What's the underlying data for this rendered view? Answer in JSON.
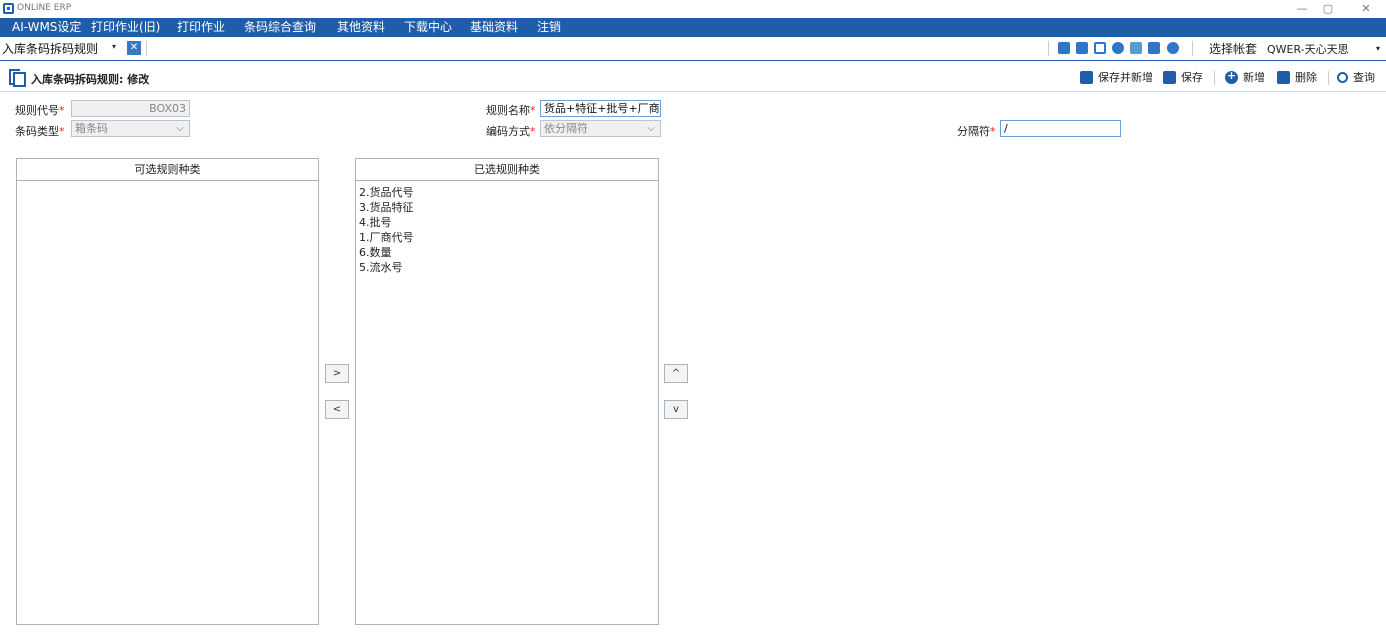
{
  "window": {
    "app_title": "ONLINE ERP",
    "minimize_glyph": "—",
    "maximize_glyph": "▢",
    "close_glyph": "✕"
  },
  "menu": {
    "items": [
      "AI-WMS设定",
      "打印作业(旧)",
      "打印作业",
      "条码综合查询",
      "其他资料",
      "下载中心",
      "基础资料",
      "注销"
    ]
  },
  "tab": {
    "label": "入库条码拆码规则",
    "caret": "▾",
    "close": "✕"
  },
  "account": {
    "label": "选择帐套",
    "value": "QWER-天心天思",
    "caret": "▾"
  },
  "page": {
    "title": "入库条码拆码规则: 修改"
  },
  "actions": {
    "save_new": "保存并新增",
    "save": "保存",
    "add": "新增",
    "delete": "删除",
    "query": "查询"
  },
  "form": {
    "rule_code_label": "规则代号",
    "rule_code_value": "BOX03",
    "rule_name_label": "规则名称",
    "rule_name_value": "货品+特征+批号+厂商+",
    "barcode_type_label": "条码类型",
    "barcode_type_value": "箱条码",
    "encode_method_label": "编码方式",
    "encode_method_value": "依分隔符",
    "separator_label": "分隔符",
    "separator_value": "/",
    "required_mark": "*",
    "chevron": "⌵"
  },
  "available": {
    "header": "可选规则种类",
    "items": []
  },
  "selected": {
    "header": "已选规则种类",
    "items": [
      "2.货品代号",
      "3.货品特征",
      "4.批号",
      "1.厂商代号",
      "6.数量",
      "5.流水号"
    ]
  },
  "move_buttons": {
    "add": ">",
    "remove": "<",
    "up": "^",
    "down": "v"
  },
  "colors": {
    "menu_bg": "#1f5da8",
    "required": "#e02020",
    "icon_blue": "#2e76c8"
  }
}
